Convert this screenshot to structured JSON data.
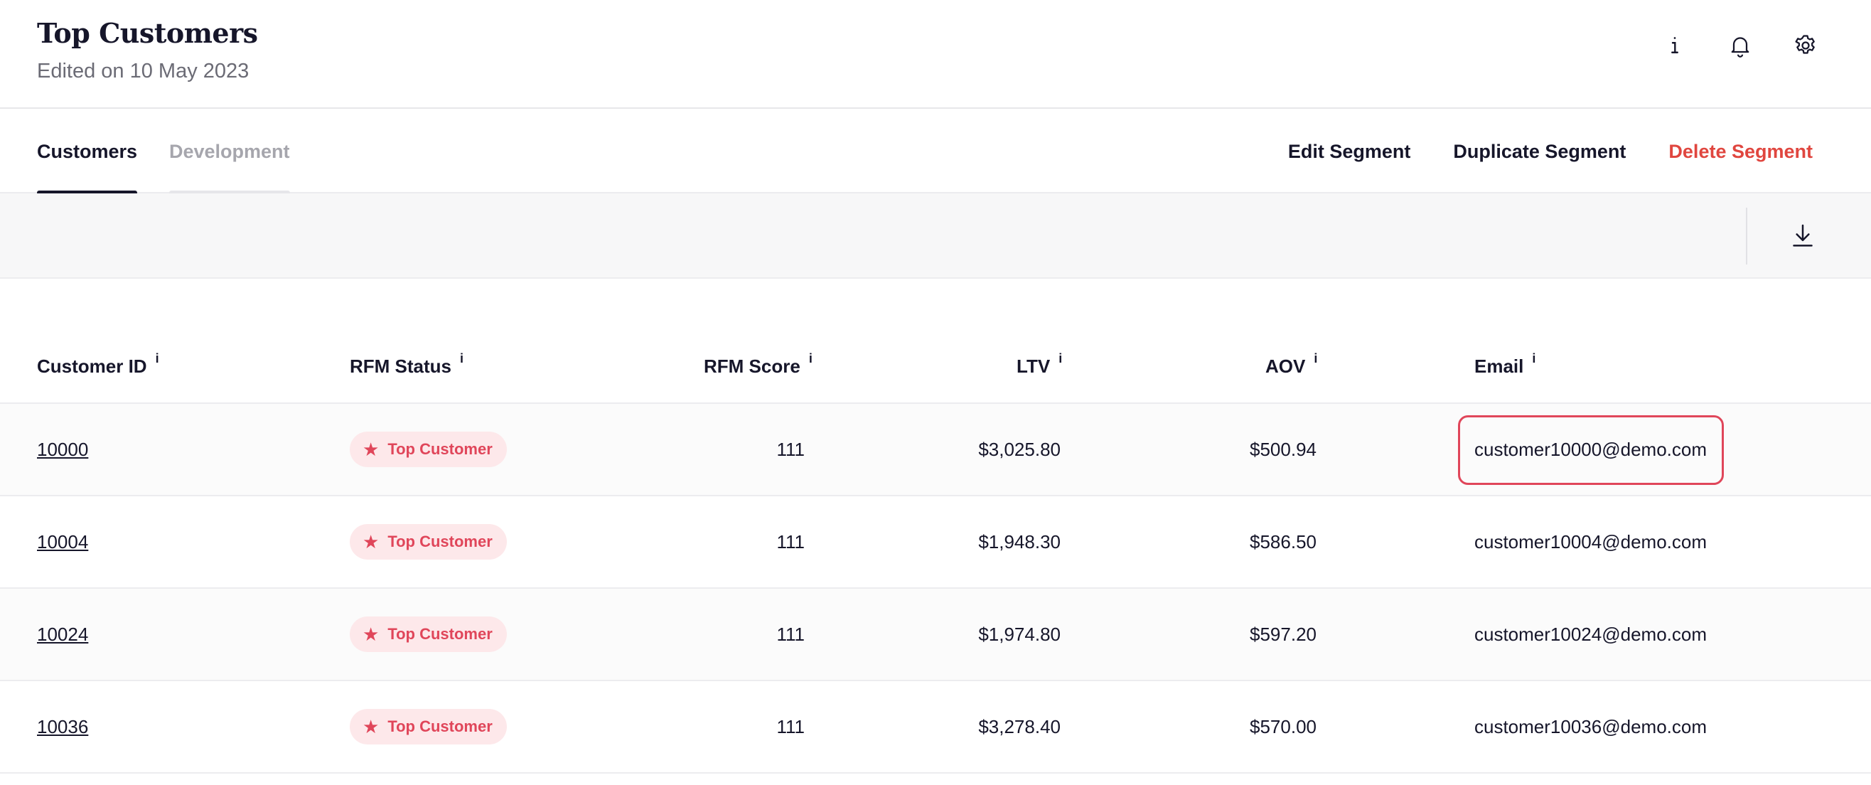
{
  "header": {
    "title": "Top Customers",
    "subtitle": "Edited on 10 May 2023",
    "icons": [
      "info-icon",
      "bell-icon",
      "gear-icon"
    ]
  },
  "tabs": [
    {
      "label": "Customers",
      "active": true
    },
    {
      "label": "Development",
      "active": false
    }
  ],
  "actions": {
    "edit": "Edit Segment",
    "duplicate": "Duplicate Segment",
    "delete": "Delete Segment"
  },
  "toolbar": {
    "download_icon": "download-icon"
  },
  "table": {
    "columns": [
      {
        "label": "Customer ID",
        "info": "i"
      },
      {
        "label": "RFM Status",
        "info": "i"
      },
      {
        "label": "RFM Score",
        "info": "i"
      },
      {
        "label": "LTV",
        "info": "i"
      },
      {
        "label": "AOV",
        "info": "i"
      },
      {
        "label": "Email",
        "info": "i"
      }
    ],
    "rows": [
      {
        "id": "10000",
        "status": "Top Customer",
        "score": "111",
        "ltv": "$3,025.80",
        "aov": "$500.94",
        "email": "customer10000@demo.com"
      },
      {
        "id": "10004",
        "status": "Top Customer",
        "score": "111",
        "ltv": "$1,948.30",
        "aov": "$586.50",
        "email": "customer10004@demo.com"
      },
      {
        "id": "10024",
        "status": "Top Customer",
        "score": "111",
        "ltv": "$1,974.80",
        "aov": "$597.20",
        "email": "customer10024@demo.com"
      },
      {
        "id": "10036",
        "status": "Top Customer",
        "score": "111",
        "ltv": "$3,278.40",
        "aov": "$570.00",
        "email": "customer10036@demo.com"
      }
    ]
  },
  "colors": {
    "accent_red": "#e0463f",
    "badge_bg": "#fde8ea",
    "badge_text": "#e0465a",
    "text_dark": "#16162a"
  }
}
